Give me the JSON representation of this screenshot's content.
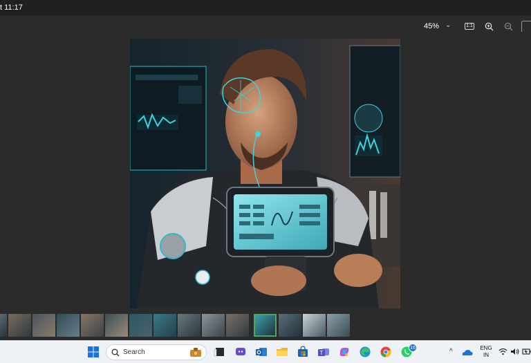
{
  "window": {
    "title": "t 11:17"
  },
  "toolbar": {
    "zoom_level": "45%"
  },
  "image": {
    "alt": "Man wearing a futuristic medical device vest with a touchscreen tablet on his chest, in a high-tech lab"
  },
  "filmstrip": {
    "thumbnail_count": 16,
    "selected_index": 10
  },
  "taskbar": {
    "search_label": "Search",
    "pinned_apps": [
      "file-manager-icon",
      "terminal-icon",
      "copilot-chat-icon",
      "outlook-icon",
      "file-explorer-icon",
      "microsoft-store-icon",
      "teams-icon",
      "copilot-icon",
      "edge-icon",
      "chrome-icon",
      "whatsapp-icon"
    ],
    "whatsapp_badge": "16",
    "language_line1": "ENG",
    "language_line2": "IN"
  },
  "colors": {
    "titlebar": "#202020",
    "viewer_bg": "#2b2b2b",
    "taskbar": "#eef1f6",
    "selected_thumb": "#4fa564",
    "accent_cyan": "#3fd2e0"
  }
}
